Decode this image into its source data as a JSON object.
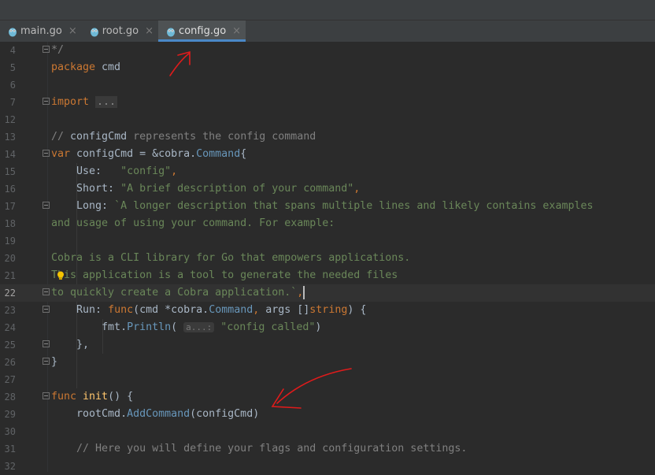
{
  "tabs": [
    {
      "label": "main.go",
      "active": false
    },
    {
      "label": "root.go",
      "active": false
    },
    {
      "label": "config.go",
      "active": true
    }
  ],
  "close_glyph": "×",
  "lines": [
    {
      "n": "4",
      "fold": true,
      "tokens": [
        {
          "t": "*/",
          "c": "cmt"
        }
      ]
    },
    {
      "n": "5",
      "tokens": [
        {
          "t": "package ",
          "c": "kw"
        },
        {
          "t": "cmd",
          "c": ""
        }
      ]
    },
    {
      "n": "6",
      "tokens": []
    },
    {
      "n": "7",
      "fold": true,
      "tokens": [
        {
          "t": "import ",
          "c": "kw"
        },
        {
          "t": "...",
          "c": "folded"
        }
      ]
    },
    {
      "n": "12",
      "tokens": []
    },
    {
      "n": "13",
      "tokens": [
        {
          "t": "// ",
          "c": "cmt"
        },
        {
          "t": "configCmd",
          "c": ""
        },
        {
          "t": " represents the config command",
          "c": "cmt"
        }
      ]
    },
    {
      "n": "14",
      "fold": true,
      "tokens": [
        {
          "t": "var ",
          "c": "kw"
        },
        {
          "t": "configCmd = &",
          "c": ""
        },
        {
          "t": "cobra",
          "c": ""
        },
        {
          "t": ".",
          "c": ""
        },
        {
          "t": "Command",
          "c": "type"
        },
        {
          "t": "{",
          "c": ""
        }
      ]
    },
    {
      "n": "15",
      "tokens": [
        {
          "t": "    Use:   ",
          "c": ""
        },
        {
          "t": "\"config\"",
          "c": "str"
        },
        {
          "t": ",",
          "c": "kw"
        }
      ]
    },
    {
      "n": "16",
      "tokens": [
        {
          "t": "    Short: ",
          "c": ""
        },
        {
          "t": "\"A brief description of your command\"",
          "c": "str"
        },
        {
          "t": ",",
          "c": "kw"
        }
      ]
    },
    {
      "n": "17",
      "fold": true,
      "tokens": [
        {
          "t": "    Long: ",
          "c": ""
        },
        {
          "t": "`A longer description that spans multiple lines and likely contains examples",
          "c": "str"
        }
      ]
    },
    {
      "n": "18",
      "tokens": [
        {
          "t": "and usage of using your command. For example:",
          "c": "str"
        }
      ]
    },
    {
      "n": "19",
      "tokens": []
    },
    {
      "n": "20",
      "tokens": [
        {
          "t": "Cobra is a CLI library for Go that empowers applications.",
          "c": "str"
        }
      ]
    },
    {
      "n": "21",
      "bulb": true,
      "tokens": [
        {
          "t": "This application is a tool to generate the needed files",
          "c": "str"
        }
      ]
    },
    {
      "n": "22",
      "current": true,
      "fold": true,
      "tokens": [
        {
          "t": "to quickly create a Cobra application.`",
          "c": "str"
        },
        {
          "t": ",",
          "c": "kw"
        }
      ],
      "caret": true
    },
    {
      "n": "23",
      "fold": true,
      "tokens": [
        {
          "t": "    Run: ",
          "c": ""
        },
        {
          "t": "func",
          "c": "kw"
        },
        {
          "t": "(cmd *",
          "c": ""
        },
        {
          "t": "cobra",
          "c": ""
        },
        {
          "t": ".",
          "c": ""
        },
        {
          "t": "Command",
          "c": "type"
        },
        {
          "t": ", ",
          "c": "kw"
        },
        {
          "t": "args []",
          "c": ""
        },
        {
          "t": "string",
          "c": "kw"
        },
        {
          "t": ") {",
          "c": ""
        }
      ]
    },
    {
      "n": "24",
      "tokens": [
        {
          "t": "        fmt",
          "c": ""
        },
        {
          "t": ".",
          "c": ""
        },
        {
          "t": "Println",
          "c": "type"
        },
        {
          "t": "( ",
          "c": ""
        },
        {
          "t": "a...:",
          "c": "hint"
        },
        {
          "t": " ",
          "c": ""
        },
        {
          "t": "\"config called\"",
          "c": "str"
        },
        {
          "t": ")",
          "c": ""
        }
      ]
    },
    {
      "n": "25",
      "fold": true,
      "tokens": [
        {
          "t": "    },",
          "c": ""
        }
      ]
    },
    {
      "n": "26",
      "fold": true,
      "tokens": [
        {
          "t": "}",
          "c": ""
        }
      ]
    },
    {
      "n": "27",
      "tokens": []
    },
    {
      "n": "28",
      "fold": true,
      "tokens": [
        {
          "t": "func ",
          "c": "kw"
        },
        {
          "t": "init",
          "c": "fn"
        },
        {
          "t": "() {",
          "c": ""
        }
      ]
    },
    {
      "n": "29",
      "tokens": [
        {
          "t": "    rootCmd",
          "c": ""
        },
        {
          "t": ".",
          "c": ""
        },
        {
          "t": "AddCommand",
          "c": "type"
        },
        {
          "t": "(configCmd)",
          "c": ""
        }
      ]
    },
    {
      "n": "30",
      "tokens": []
    },
    {
      "n": "31",
      "tokens": [
        {
          "t": "    // Here you will define your flags and configuration settings.",
          "c": "cmt"
        }
      ]
    },
    {
      "n": "32",
      "tokens": []
    }
  ],
  "colors": {
    "background": "#2b2b2b",
    "keyword": "#cc7832",
    "string": "#6a8759",
    "comment": "#808080",
    "accent": "#4a88c7",
    "annotation": "#e01b1b"
  }
}
